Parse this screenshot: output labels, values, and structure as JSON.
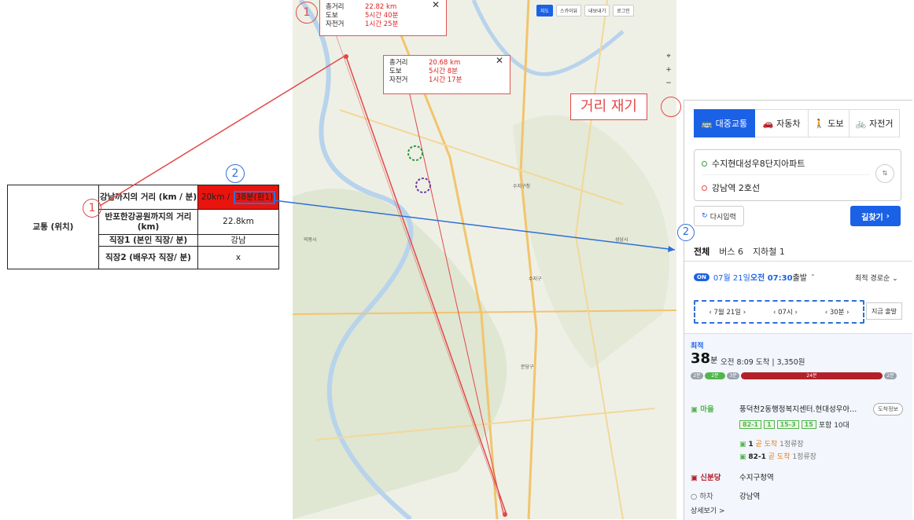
{
  "sheet": {
    "category": "교통 (위치)",
    "rows": [
      {
        "label": "강남까지의 거리 (km / 분)",
        "value_km": "20km / ",
        "value_time": "38분(환1)"
      },
      {
        "label": "반포한강공원까지의 거리 (km)",
        "value": "22.8km"
      },
      {
        "label": "직장1 (본인 직장/ 분)",
        "value": "강남"
      },
      {
        "label": "직장2 (배우자 직장/ 분)",
        "value": "x"
      }
    ]
  },
  "markers": {
    "one": "1",
    "two": "2"
  },
  "popups": [
    {
      "rows": [
        {
          "k": "총거리",
          "v": "22.82 km"
        },
        {
          "k": "도보",
          "v": "5시간 40분"
        },
        {
          "k": "자전거",
          "v": "1시간 25분"
        }
      ],
      "close": "✕"
    },
    {
      "rows": [
        {
          "k": "총거리",
          "v": "20.68 km"
        },
        {
          "k": "도보",
          "v": "5시간 8분"
        },
        {
          "k": "자전거",
          "v": "1시간 17분"
        }
      ],
      "close": "✕"
    }
  ],
  "map": {
    "tools": [
      "지도",
      "스카이뷰",
      "내보내기",
      "로그인"
    ],
    "measure_label": "거리 재기",
    "labels": [
      "수지구청",
      "분당구",
      "성남시",
      "수지구",
      "의왕시"
    ],
    "zoom": [
      "⌖",
      "+",
      "−"
    ]
  },
  "panel": {
    "modes": [
      {
        "icon": "🚌",
        "label": "대중교통",
        "active": true
      },
      {
        "icon": "🚗",
        "label": "자동차",
        "active": false
      },
      {
        "icon": "🚶",
        "label": "도보",
        "active": false
      },
      {
        "icon": "🚲",
        "label": "자전거",
        "active": false
      }
    ],
    "origin": "수지현대성우8단지아파트",
    "destination": "강남역 2호선",
    "swap": "⇅",
    "reset": "다시입력",
    "search": "길찾기",
    "tabs": [
      "전체",
      "버스 6",
      "지하철 1"
    ],
    "on_badge": "ON",
    "departure_date": "07월 21일 ",
    "departure_time": "오전 07:30",
    "departure_suffix": " 출발",
    "sort": "최적 경로순",
    "time_selector": [
      "7월 21일",
      "07시",
      "30분"
    ],
    "now": "지금 출발",
    "result": {
      "tag": "최적",
      "minutes": "38",
      "unit": "분",
      "arrive": "오전 8:09 도착  |  3,350원",
      "bar": [
        {
          "label": "2분",
          "color": "#9aa3ad"
        },
        {
          "label": "2분",
          "color": "#52b64d"
        },
        {
          "label": "3분",
          "color": "#9aa3ad"
        },
        {
          "label": "24분",
          "color": "#b3202a"
        },
        {
          "label": "2분",
          "color": "#9aa3ad"
        }
      ],
      "leg1_mode": "마을",
      "leg1_stop": "풍덕천2동행정복지센터.현대성우아...",
      "stop_info": "도착정보",
      "routes": [
        "82-1",
        "1",
        "15-3",
        "15"
      ],
      "routes_more": "포함 10대",
      "arrivals": [
        {
          "route": "1",
          "status": "곧 도착",
          "stops": "1정류장"
        },
        {
          "route": "82-1",
          "status": "곧 도착",
          "stops": "1정류장"
        }
      ],
      "leg2_mode": "신분당",
      "leg2_stop": "수지구청역",
      "leg3_mode": "하차",
      "leg3_stop": "강남역",
      "detail": "상세보기 >"
    }
  },
  "colors": {
    "accent": "#1b61e6",
    "annotation_red": "#e34848",
    "annotation_blue": "#2f6fd6"
  }
}
